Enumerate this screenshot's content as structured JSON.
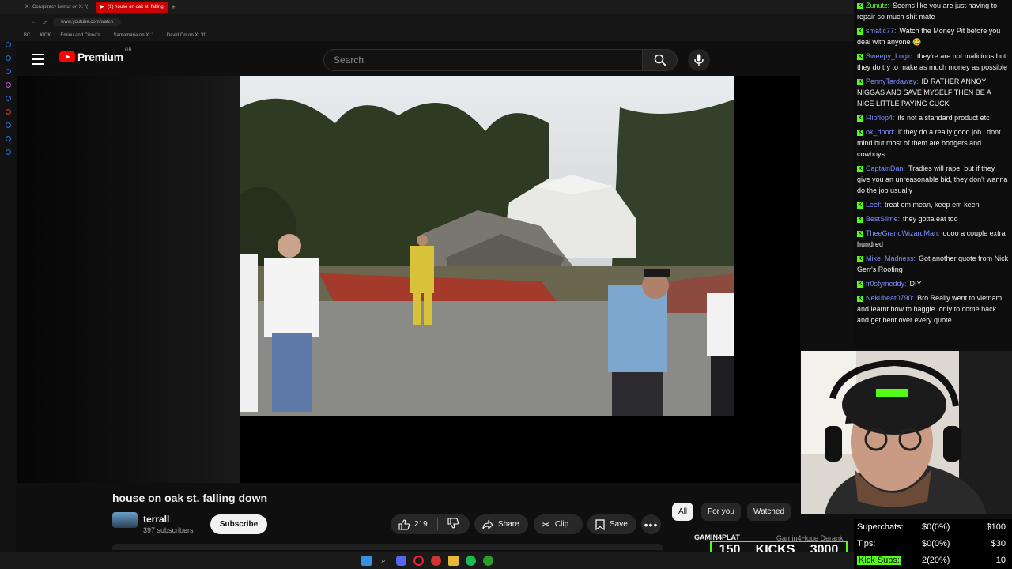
{
  "browser": {
    "tabs": [
      {
        "label": "Conspiracy Lemur on X: \"(",
        "active": false
      },
      {
        "label": "(1) house on oak st. falling",
        "active": true
      }
    ],
    "new_tab": "+",
    "url": "www.youtube.com/watch",
    "bookmarks": [
      "BC",
      "KICK",
      "Eminu and Cinna's...",
      "Santamaria on X: \"...",
      "David Orr on X: \"If..."
    ]
  },
  "youtube": {
    "logo_text": "Premium",
    "region": "GB",
    "search_placeholder": "Search",
    "video": {
      "title": "house on oak st. falling down",
      "channel": "terrall",
      "subscribers": "397 subscribers",
      "subscribe_label": "Subscribe",
      "likes": "219",
      "share_label": "Share",
      "clip_label": "Clip",
      "save_label": "Save"
    },
    "chips": [
      "All",
      "For you",
      "Watched"
    ]
  },
  "chat": {
    "messages": [
      {
        "user": "Zunutz:",
        "color": "#53fc18",
        "text": "Seems like you are just having to repair so much shit mate"
      },
      {
        "user": "smatic77:",
        "color": "#7b8cff",
        "text": "Watch the Money Pit before you deal with anyone 😂"
      },
      {
        "user": "Sweepy_Logic:",
        "color": "#7b8cff",
        "text": "they're are not malicious but they do try to make as much money as possible"
      },
      {
        "user": "PennyTardaway:",
        "color": "#7b8cff",
        "text": "ID RATHER ANNOY NIGGAS AND SAVE MYSELF THEN BE A NICE LITTLE PAYING CUCK"
      },
      {
        "user": "Flipflop4:",
        "color": "#7b8cff",
        "text": "its not a standard product etc"
      },
      {
        "user": "ok_dood:",
        "color": "#7b8cff",
        "text": "if they do a really good job i dont mind but most of them are bodgers and cowboys"
      },
      {
        "user": "CaptainDan:",
        "color": "#7b8cff",
        "text": "Tradies will rape, but if they give you an unreasonable bid, they don't wanna do the job usually"
      },
      {
        "user": "Leef:",
        "color": "#7b8cff",
        "text": "treat em mean, keep em keen"
      },
      {
        "user": "BestSlime:",
        "color": "#7b8cff",
        "text": "they gotta eat too"
      },
      {
        "user": "TheeGrandWizardMan:",
        "color": "#7b8cff",
        "text": "oooo a couple extra hundred"
      },
      {
        "user": "Mike_Madness:",
        "color": "#7b8cff",
        "text": "Got another quote from Nick Gerr's Roofing"
      },
      {
        "user": "fr0stymeddy:",
        "color": "#7b8cff",
        "text": "DIY"
      },
      {
        "user": "Nekubeat0790:",
        "color": "#7b8cff",
        "text": "Bro Really went to vietnam and learnt how to haggle ,only to come back and get bent over every quote"
      }
    ]
  },
  "kicks_overlay": {
    "top_label": "GAMIN4PLAT",
    "top_label_2": "Gamin4Hope Derank",
    "count": "150",
    "word": "KICKS",
    "goal": "3000"
  },
  "stats": {
    "rows": [
      {
        "label": "Superchats:",
        "value": "$0(0%)",
        "goal": "$100"
      },
      {
        "label": "Tips:",
        "value": "$0(0%)",
        "goal": "$30"
      },
      {
        "label": "Kick Subs:",
        "value": "2(20%)",
        "goal": "10"
      }
    ]
  },
  "colors": {
    "kick_green": "#53fc18",
    "yt_red": "#ff0000"
  }
}
